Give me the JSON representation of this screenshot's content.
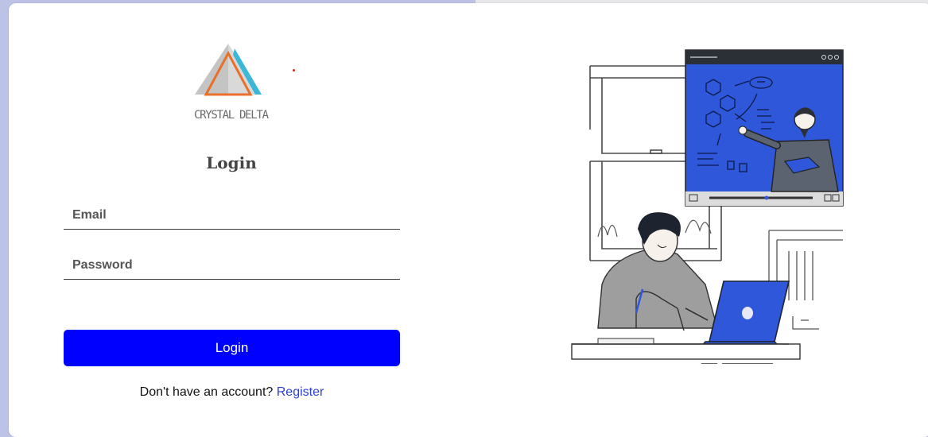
{
  "brand": {
    "logo_text": "CRYSTAL DELTA",
    "logo_colors": {
      "gray": "#bdbdbd",
      "orange": "#e8702a",
      "cyan": "#3bb7d8"
    }
  },
  "form": {
    "title": "Login",
    "email_placeholder": "Email",
    "password_placeholder": "Password",
    "submit_label": "Login",
    "register_prompt": "Don't have an account?",
    "register_link": "Register"
  },
  "colors": {
    "primary_button": "#0000ff",
    "link": "#2b3fd6",
    "illustration_blue": "#2f57d9",
    "page_background": "#bcc3e6"
  },
  "icons": {
    "illustration": "student-online-learning-illustration",
    "logo": "crystal-delta-triangle-logo"
  }
}
